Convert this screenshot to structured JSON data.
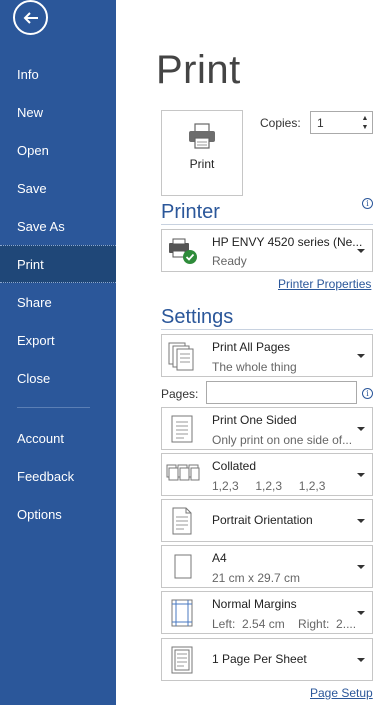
{
  "nav": {
    "items": [
      {
        "label": "Info"
      },
      {
        "label": "New"
      },
      {
        "label": "Open"
      },
      {
        "label": "Save"
      },
      {
        "label": "Save As"
      },
      {
        "label": "Print"
      },
      {
        "label": "Share"
      },
      {
        "label": "Export"
      },
      {
        "label": "Close"
      },
      {
        "label": "Account"
      },
      {
        "label": "Feedback"
      },
      {
        "label": "Options"
      }
    ],
    "active": "Print"
  },
  "page_title": "Print",
  "print_button_label": "Print",
  "copies": {
    "label": "Copies:",
    "value": "1"
  },
  "printer": {
    "heading": "Printer",
    "name": "HP ENVY 4520 series (Ne...",
    "status": "Ready",
    "properties_link": "Printer Properties"
  },
  "settings": {
    "heading": "Settings",
    "pages_label": "Pages:",
    "pages_value": "",
    "items": [
      {
        "title": "Print All Pages",
        "subtitle": "The whole thing"
      },
      {
        "title": "Print One Sided",
        "subtitle": "Only print on one side of..."
      },
      {
        "title": "Collated",
        "subtitle": "1,2,3     1,2,3     1,2,3"
      },
      {
        "title": "Portrait Orientation",
        "subtitle": ""
      },
      {
        "title": "A4",
        "subtitle": "21 cm x 29.7 cm"
      },
      {
        "title": "Normal Margins",
        "subtitle": "Left:  2.54 cm    Right:  2...."
      },
      {
        "title": "1 Page Per Sheet",
        "subtitle": ""
      }
    ]
  },
  "page_setup_link": "Page Setup",
  "colors": {
    "sidebar": "#2b579a",
    "active_nav": "#1f4778",
    "accent": "#2b579a"
  }
}
